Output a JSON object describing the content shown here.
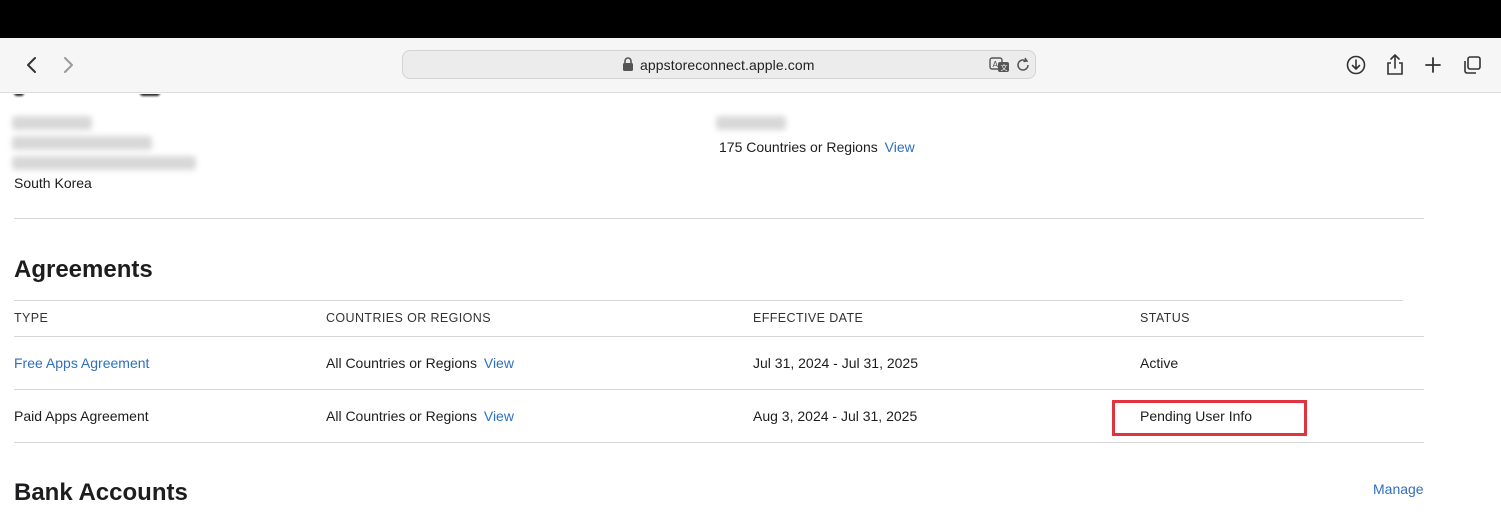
{
  "browser": {
    "url": "appstoreconnect.apple.com"
  },
  "account": {
    "country": "South Korea",
    "regions_text": "175 Countries or Regions",
    "regions_link": "View"
  },
  "agreements": {
    "title": "Agreements",
    "columns": [
      "TYPE",
      "COUNTRIES OR REGIONS",
      "EFFECTIVE DATE",
      "STATUS"
    ],
    "rows": [
      {
        "type": "Free Apps Agreement",
        "countries": "All Countries or Regions",
        "countries_link": "View",
        "effective_date": "Jul 31, 2024 - Jul 31, 2025",
        "status": "Active"
      },
      {
        "type": "Paid Apps Agreement",
        "countries": "All Countries or Regions",
        "countries_link": "View",
        "effective_date": "Aug 3, 2024 - Jul 31, 2025",
        "status": "Pending User Info"
      }
    ]
  },
  "bank_accounts": {
    "title": "Bank Accounts",
    "manage_link": "Manage"
  },
  "colors": {
    "link": "#2e6fbf",
    "highlight": "#e0333f"
  }
}
